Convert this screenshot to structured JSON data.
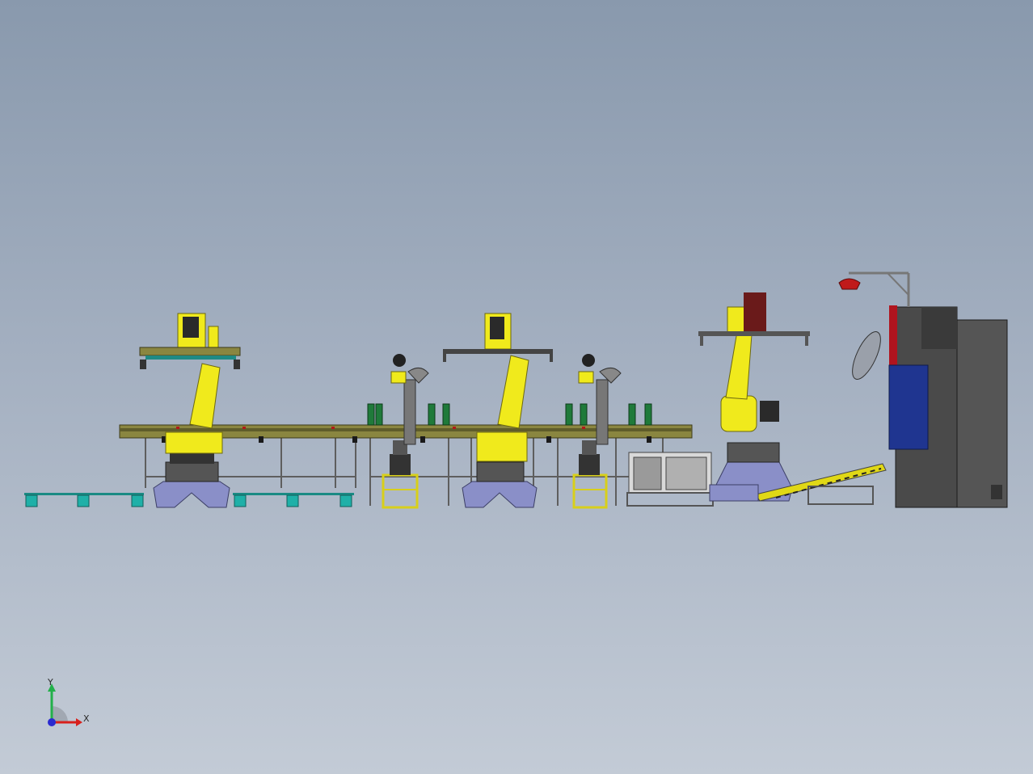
{
  "viewport": {
    "background_top": "#8999ad",
    "background_bottom": "#c3cbd6"
  },
  "triad": {
    "y_label": "Y",
    "x_label": "X",
    "y_color": "#22b04a",
    "x_color": "#d8201c",
    "z_color": "#2a2ad0"
  },
  "colors": {
    "robot_yellow": "#f0ea1c",
    "robot_dark": "#2a2a2a",
    "pedestal": "#8a8fc8",
    "pallet": "#1fb0a8",
    "conveyor": "#7d7a3c",
    "frame": "#6e6e6e",
    "press_brake_body": "#4a4a4a",
    "press_brake_blue": "#1f3590",
    "press_brake_red": "#b0141e",
    "roller_green": "#1f7a3a"
  },
  "components": [
    "pallet-left",
    "pallet-middle",
    "palletizing-robot-1",
    "welding-robot-1",
    "palletizing-robot-2",
    "welding-robot-2",
    "loading-robot-3",
    "conveyor-line",
    "feeding-table",
    "inclined-loader",
    "press-brake",
    "overhead-light"
  ]
}
